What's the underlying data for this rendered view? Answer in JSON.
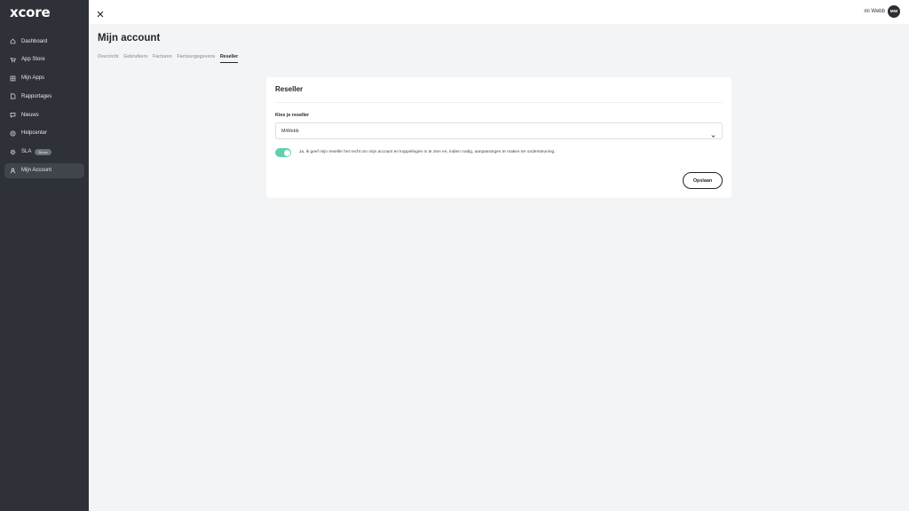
{
  "brand": {
    "logo": "xcore"
  },
  "sidebar": {
    "items": [
      {
        "label": "Dashboard",
        "icon": "home-icon"
      },
      {
        "label": "App Store",
        "icon": "cart-icon"
      },
      {
        "label": "Mijn Apps",
        "icon": "apps-icon"
      },
      {
        "label": "Rapportages",
        "icon": "report-icon"
      },
      {
        "label": "Nieuws",
        "icon": "news-icon"
      },
      {
        "label": "Helpcenter",
        "icon": "help-icon"
      },
      {
        "label": "SLA",
        "icon": "gear-icon",
        "badge": "Bronz"
      },
      {
        "label": "Mijn Account",
        "icon": "user-icon",
        "active": true
      }
    ]
  },
  "topbar": {
    "user_name": "mi Webb",
    "avatar_initials": "MW"
  },
  "page": {
    "title": "Mijn account",
    "tabs": [
      {
        "label": "Overzicht"
      },
      {
        "label": "Gebruikers"
      },
      {
        "label": "Facturen"
      },
      {
        "label": "Factuurgegevens"
      },
      {
        "label": "Reseller",
        "active": true
      }
    ]
  },
  "card": {
    "header": "Reseller",
    "field_label": "Kies je reseller",
    "select_value": "MiWebb",
    "toggle_on": true,
    "toggle_text": "Ja, ik geef mijn reseller het recht om mijn account en koppelingen in te zien en, indien nodig, aanpassingen te maken ter ondersteuning.",
    "save_label": "Opslaan"
  },
  "colors": {
    "sidebar_bg": "#2e3138",
    "toggle_accent": "#5ecfb1",
    "page_bg": "#f3f4f6"
  }
}
